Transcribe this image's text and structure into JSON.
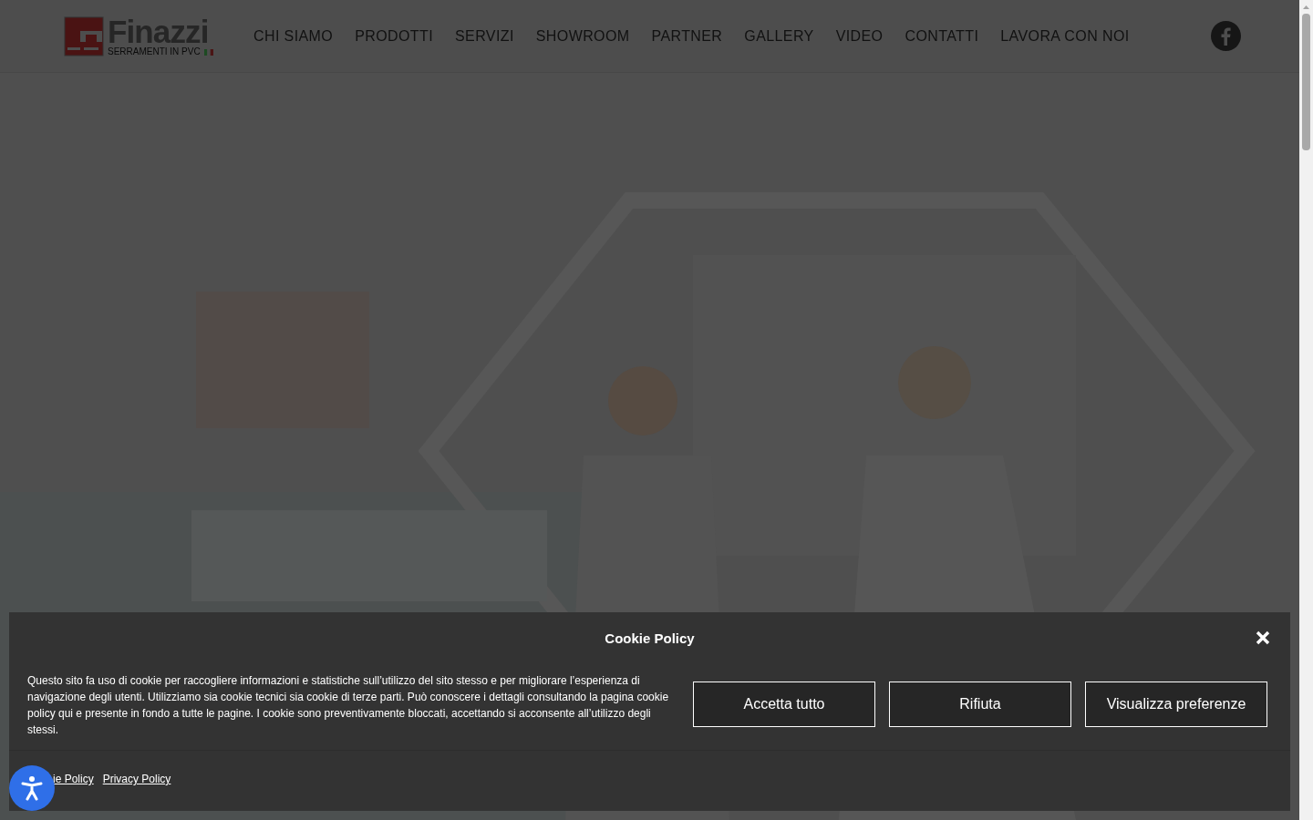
{
  "logo": {
    "name": "Finazzi",
    "tagline": "SERRAMENTI IN PVC"
  },
  "nav": [
    {
      "label": "CHI SIAMO"
    },
    {
      "label": "PRODOTTI"
    },
    {
      "label": "SERVIZI"
    },
    {
      "label": "SHOWROOM"
    },
    {
      "label": "PARTNER"
    },
    {
      "label": "GALLERY"
    },
    {
      "label": "VIDEO"
    },
    {
      "label": "CONTATTI"
    },
    {
      "label": "LAVORA CON NOI"
    }
  ],
  "cookie_banner": {
    "title": "Cookie Policy",
    "message": "Questo sito fa uso di cookie per raccogliere informazioni e statistiche sull’utilizzo del sito stesso e per migliorare l’esperienza di navigazione degli utenti. Utilizziamo sia cookie tecnici sia cookie di terze parti. Può conoscere i dettagli consultando la pagina cookie policy qui e presente in fondo a tutte le pagine. I cookie sono preventivamente bloccati, accettando si acconsente all’utilizzo degli stessi.",
    "buttons": [
      "Accetta tutto",
      "Rifiuta",
      "Visualizza preferenze"
    ],
    "links": [
      "ie Policy",
      "Privacy Policy"
    ]
  }
}
